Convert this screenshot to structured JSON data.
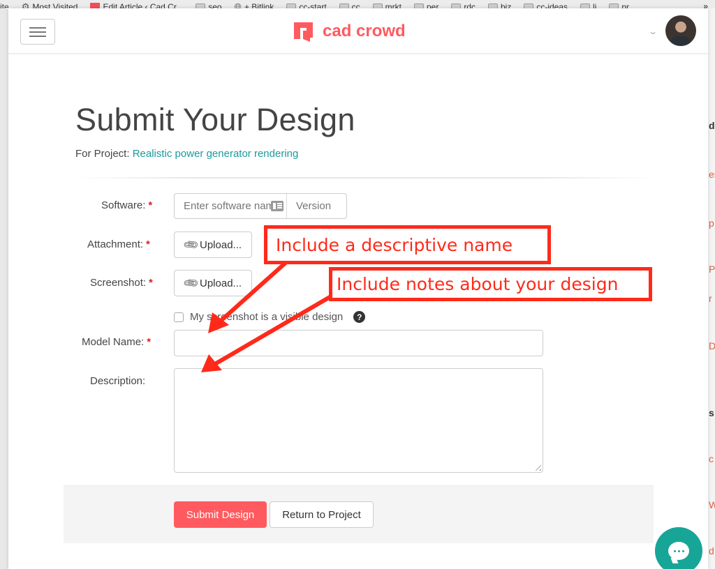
{
  "browser": {
    "bookmarks": [
      {
        "label": "ite",
        "icon": "none"
      },
      {
        "label": "Most Visited",
        "icon": "gear-icon"
      },
      {
        "label": "Edit Article ‹ Cad Cr...",
        "icon": "cadcrowd-icon"
      },
      {
        "label": "seo",
        "icon": "folder-icon"
      },
      {
        "label": "+ Bitlink",
        "icon": "globe-icon"
      },
      {
        "label": "cc-start",
        "icon": "folder-icon"
      },
      {
        "label": "cc",
        "icon": "folder-icon"
      },
      {
        "label": "mrkt",
        "icon": "folder-icon"
      },
      {
        "label": "per",
        "icon": "folder-icon"
      },
      {
        "label": "rdc",
        "icon": "folder-icon"
      },
      {
        "label": "biz",
        "icon": "folder-icon"
      },
      {
        "label": "cc-ideas",
        "icon": "folder-icon"
      },
      {
        "label": "li",
        "icon": "folder-icon"
      },
      {
        "label": "pr",
        "icon": "folder-icon"
      }
    ],
    "overflow_label": "»"
  },
  "header": {
    "logo_text": "cad crowd",
    "brand_color": "#ff5a5f",
    "user_menu_chevron": "⌄"
  },
  "page": {
    "title": "Submit Your Design",
    "project_prefix": "For Project:",
    "project_link": "Realistic power generator rendering"
  },
  "form": {
    "software": {
      "label": "Software:",
      "required_mark": "*",
      "name_placeholder": "Enter software name",
      "version_placeholder": "Version"
    },
    "attachment": {
      "label": "Attachment:",
      "required_mark": "*",
      "button_label": "Upload..."
    },
    "screenshot": {
      "label": "Screenshot:",
      "required_mark": "*",
      "button_label": "Upload...",
      "visible_checkbox_label": "My screenshot is a visible design",
      "visible_checked": false,
      "help_icon": "?"
    },
    "model_name": {
      "label": "Model Name:",
      "required_mark": "*",
      "value": ""
    },
    "description": {
      "label": "Description:",
      "value": ""
    }
  },
  "footer": {
    "submit_label": "Submit Design",
    "return_label": "Return to Project"
  },
  "annotations": [
    {
      "text": "Include a descriptive name",
      "color": "#ff2a1a"
    },
    {
      "text": "Include notes about your design",
      "color": "#ff2a1a"
    }
  ],
  "chat": {
    "color": "#17a597"
  },
  "background_page": {
    "fragments": [
      "d",
      "es",
      "p",
      "Po",
      "r",
      "D",
      "s",
      "c",
      "W",
      "d"
    ]
  }
}
